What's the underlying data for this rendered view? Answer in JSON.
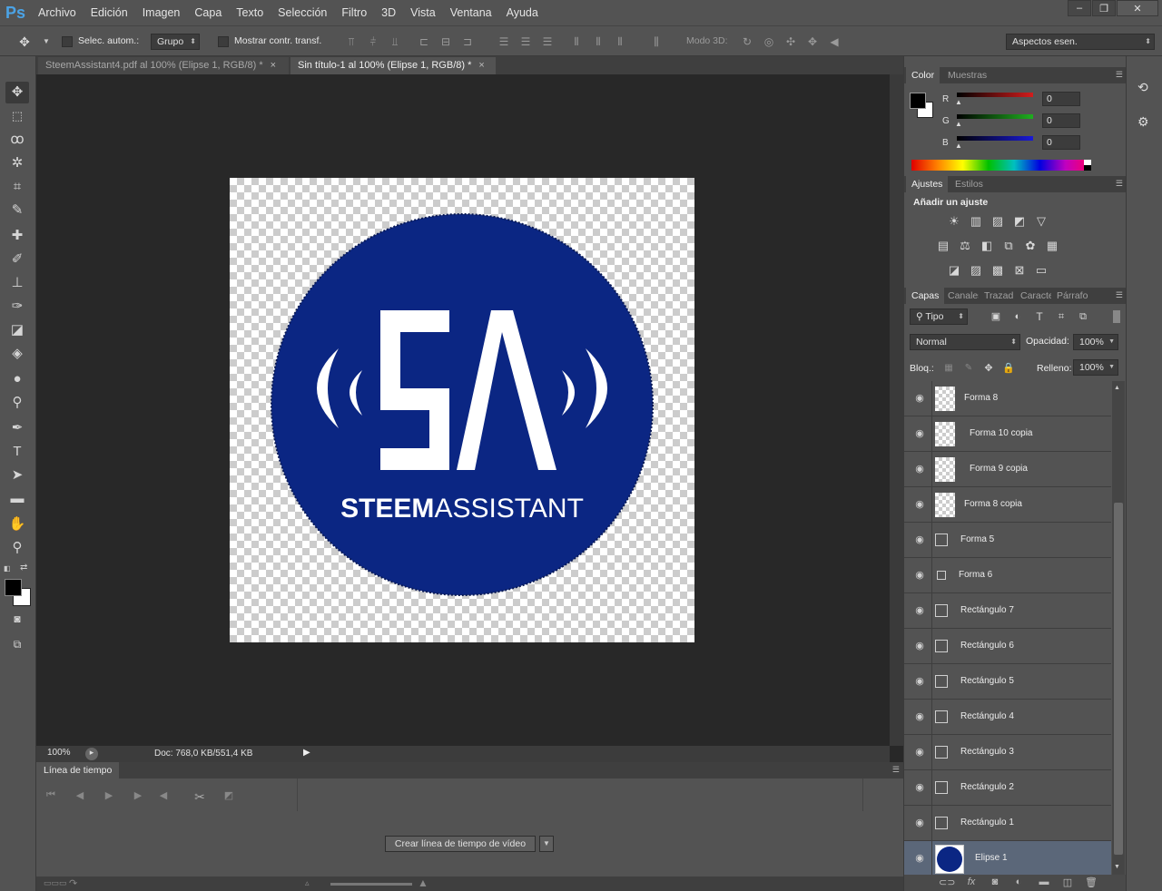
{
  "app": {
    "logo": "Ps"
  },
  "menu": [
    "Archivo",
    "Edición",
    "Imagen",
    "Capa",
    "Texto",
    "Selección",
    "Filtro",
    "3D",
    "Vista",
    "Ventana",
    "Ayuda"
  ],
  "window_controls": {
    "minimize": "–",
    "restore": "❐",
    "close": "✕"
  },
  "options": {
    "auto_select_label": "Selec. autom.:",
    "auto_select_value": "Grupo",
    "show_transform_label": "Mostrar contr. transf.",
    "mode3d_label": "Modo 3D:",
    "workspace_value": "Aspectos esen."
  },
  "tabs": [
    {
      "label": "SteemAssistant4.pdf al 100% (Elipse 1, RGB/8) *",
      "close": "×"
    },
    {
      "label": "Sin título-1 al 100% (Elipse 1, RGB/8) *",
      "close": "×"
    }
  ],
  "document": {
    "logo_letters": "SA",
    "logo_text_bold": "STEEM",
    "logo_text_light": "ASSISTANT",
    "circle_color": "#0b2683"
  },
  "status": {
    "zoom": "100%",
    "doc_info": "Doc: 768,0 KB/551,4 KB"
  },
  "timeline": {
    "title": "Línea de tiempo",
    "create_button": "Crear línea de tiempo de vídeo"
  },
  "color_panel": {
    "tabs": [
      "Color",
      "Muestras"
    ],
    "channels": [
      {
        "label": "R",
        "value": "0",
        "color": "#d21d1d"
      },
      {
        "label": "G",
        "value": "0",
        "color": "#1fae1f"
      },
      {
        "label": "B",
        "value": "0",
        "color": "#1a1ad6"
      }
    ]
  },
  "adjustments_panel": {
    "tabs": [
      "Ajustes",
      "Estilos"
    ],
    "title": "Añadir un ajuste"
  },
  "layers_panel": {
    "tabs": [
      "Capas",
      "Canales",
      "Trazad",
      "Caracte",
      "Párrafo"
    ],
    "filter_kind": "Tipo",
    "blend_mode": "Normal",
    "opacity_label": "Opacidad:",
    "opacity_value": "100%",
    "lock_label": "Bloq.:",
    "fill_label": "Relleno:",
    "fill_value": "100%",
    "layers": [
      {
        "name": "Forma 8",
        "type": "shape-thumb"
      },
      {
        "name": "Forma 10 copia",
        "type": "shape-thumb"
      },
      {
        "name": "Forma 9 copia",
        "type": "shape-thumb"
      },
      {
        "name": "Forma 8 copia",
        "type": "shape-thumb"
      },
      {
        "name": "Forma 5",
        "type": "shape"
      },
      {
        "name": "Forma 6",
        "type": "shape"
      },
      {
        "name": "Rectángulo 7",
        "type": "shape"
      },
      {
        "name": "Rectángulo 6",
        "type": "shape"
      },
      {
        "name": "Rectángulo 5",
        "type": "shape"
      },
      {
        "name": "Rectángulo 4",
        "type": "shape"
      },
      {
        "name": "Rectángulo 3",
        "type": "shape"
      },
      {
        "name": "Rectángulo 2",
        "type": "shape"
      },
      {
        "name": "Rectángulo 1",
        "type": "shape"
      },
      {
        "name": "Elipse 1",
        "type": "ellipse",
        "selected": true
      }
    ]
  }
}
